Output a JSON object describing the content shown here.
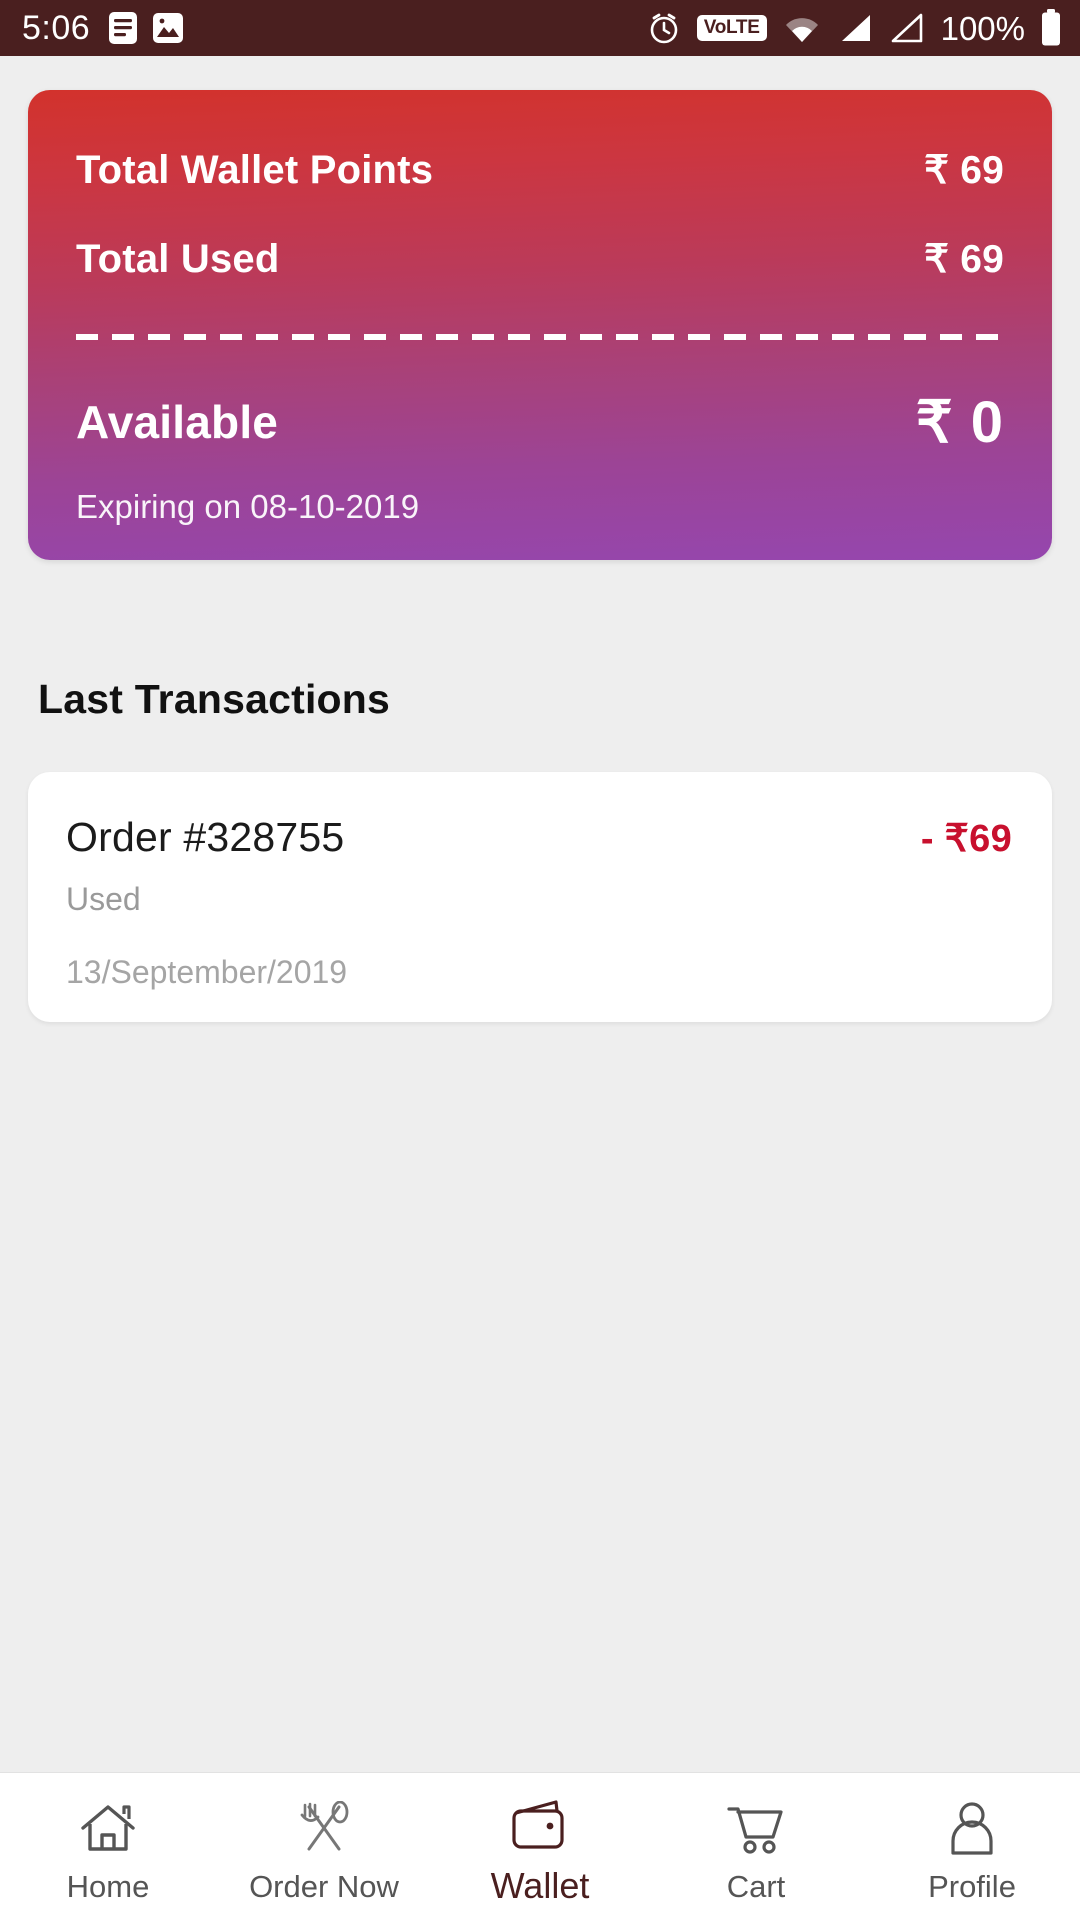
{
  "status_bar": {
    "time": "5:06",
    "left_icons": [
      "notes-icon",
      "image-icon"
    ],
    "right_icons": [
      "alarm-icon",
      "volte-icon",
      "wifi-icon",
      "signal-icon",
      "signal-alt-icon"
    ],
    "volte_label": "VoLTE",
    "battery_percent": "100%",
    "background_color": "#4a1f1f"
  },
  "wallet_card": {
    "total_points_label": "Total Wallet Points",
    "total_points_value": "₹ 69",
    "total_used_label": "Total Used",
    "total_used_value": "₹ 69",
    "available_label": "Available",
    "available_value": "₹ 0",
    "expiry_text": "Expiring on 08-10-2019",
    "gradient_start": "#d2322c",
    "gradient_end": "#9546ae"
  },
  "transactions": {
    "section_title": "Last Transactions",
    "items": [
      {
        "order": "Order #328755",
        "amount": "- ₹69",
        "status": "Used",
        "date": "13/September/2019",
        "amount_color": "#c8102e"
      }
    ]
  },
  "bottom_nav": {
    "active_color": "#4a1f1f",
    "inactive_color": "#555555",
    "items": [
      {
        "label": "Home",
        "icon": "home-icon",
        "active": false
      },
      {
        "label": "Order Now",
        "icon": "cutlery-icon",
        "active": false
      },
      {
        "label": "Wallet",
        "icon": "wallet-icon",
        "active": true
      },
      {
        "label": "Cart",
        "icon": "cart-icon",
        "active": false
      },
      {
        "label": "Profile",
        "icon": "person-icon",
        "active": false
      }
    ]
  }
}
